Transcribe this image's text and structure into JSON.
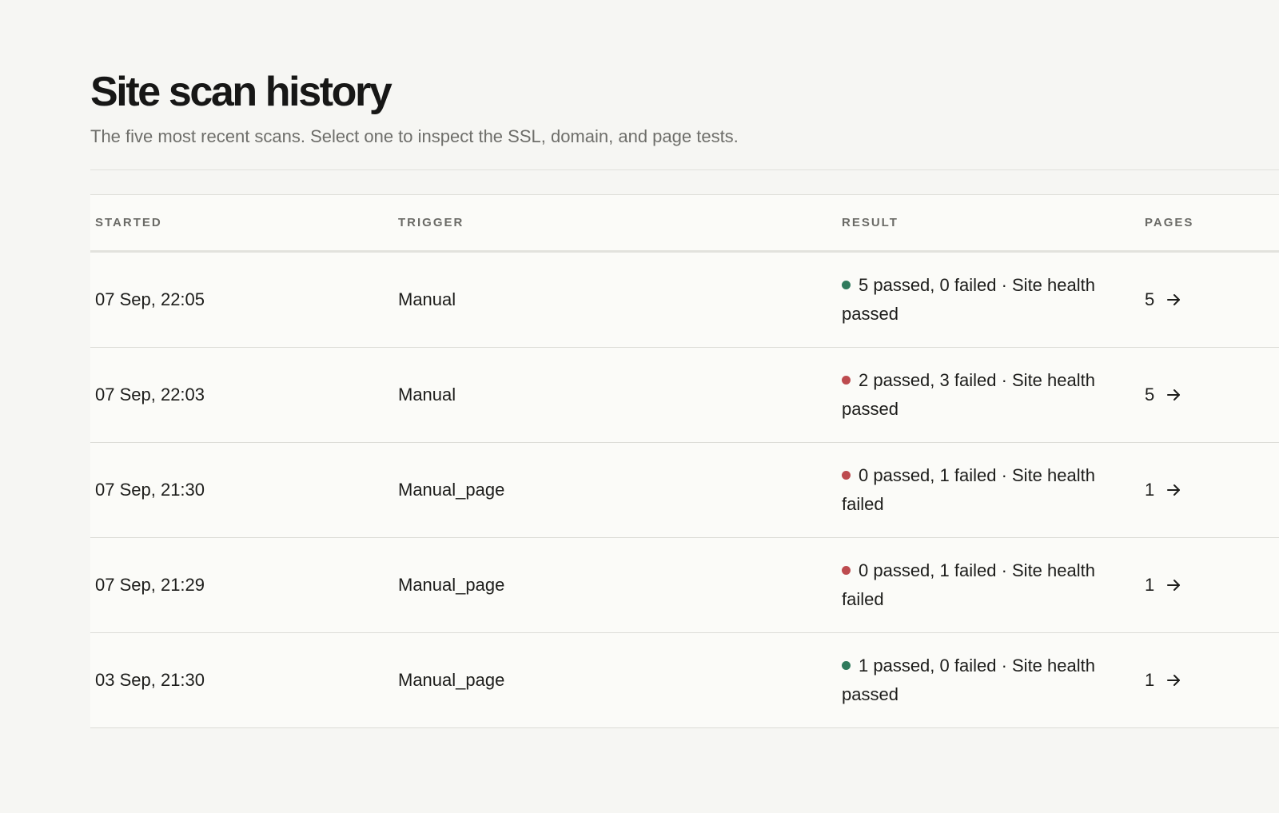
{
  "header": {
    "title": "Site scan history",
    "subtitle": "The five most recent scans. Select one to inspect the SSL, domain, and page tests."
  },
  "table": {
    "columns": {
      "started": "STARTED",
      "trigger": "TRIGGER",
      "result": "RESULT",
      "pages": "PAGES"
    },
    "rows": [
      {
        "started": "07 Sep, 22:05",
        "trigger": "Manual",
        "result": "5 passed, 0 failed · Site health passed",
        "status": "success",
        "pages": "5",
        "icon": "arrow-right-icon"
      },
      {
        "started": "07 Sep, 22:03",
        "trigger": "Manual",
        "result": "2 passed, 3 failed · Site health passed",
        "status": "failure",
        "pages": "5",
        "icon": "arrow-right-icon"
      },
      {
        "started": "07 Sep, 21:30",
        "trigger": "Manual_page",
        "result": "0 passed, 1 failed · Site health failed",
        "status": "failure",
        "pages": "1",
        "icon": "arrow-right-icon"
      },
      {
        "started": "07 Sep, 21:29",
        "trigger": "Manual_page",
        "result": "0 passed, 1 failed · Site health failed",
        "status": "failure",
        "pages": "1",
        "icon": "arrow-right-icon"
      },
      {
        "started": "03 Sep, 21:30",
        "trigger": "Manual_page",
        "result": "1 passed, 0 failed · Site health passed",
        "status": "success",
        "pages": "1",
        "icon": "arrow-right-icon"
      }
    ]
  },
  "colors": {
    "success": "#2f7a5c",
    "failure": "#bd4b4f",
    "background": "#f6f6f3",
    "table_background": "#fbfbf8"
  }
}
